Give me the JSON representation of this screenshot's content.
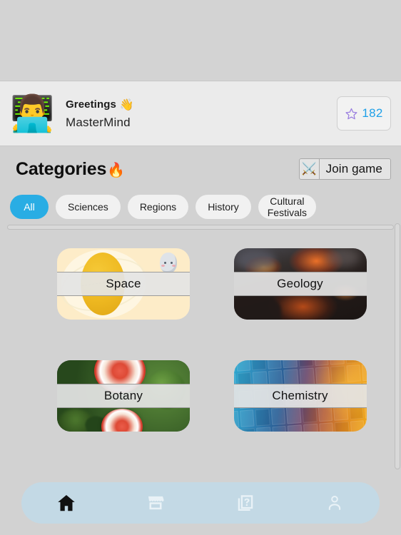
{
  "app": {
    "background_color": "#d2d2d2"
  },
  "header": {
    "avatar_icon": "man-technologist-emoji",
    "avatar_glyph": "👨‍💻",
    "greeting_text": "Greetings",
    "greeting_emoji": "👋",
    "user_name": "MasterMind",
    "score": {
      "icon": "star-icon",
      "value": "182",
      "value_color": "#1fa0e8",
      "star_color": "#9b7fe0"
    }
  },
  "title_row": {
    "title": "Categories",
    "title_emoji": "🔥",
    "join_button": {
      "label": "Join game",
      "icon": "crossed-swords-icon",
      "icon_glyph": "⚔️"
    }
  },
  "filters": {
    "active_index": 0,
    "active_color": "#29ade4",
    "chips": [
      {
        "label": "All"
      },
      {
        "label": "Sciences"
      },
      {
        "label": "Regions"
      },
      {
        "label": "History"
      },
      {
        "label": "Cultural\nFestivals"
      }
    ]
  },
  "categories": [
    {
      "label": "Space",
      "art": "art-space"
    },
    {
      "label": "Geology",
      "art": "art-geology"
    },
    {
      "label": "Botany",
      "art": "art-botany"
    },
    {
      "label": "Chemistry",
      "art": "art-chemistry"
    }
  ],
  "bottom_nav": {
    "background_color": "#c3d9e5",
    "active_index": 0,
    "items": [
      {
        "icon": "home-icon",
        "label": "Home"
      },
      {
        "icon": "store-icon",
        "label": "Store"
      },
      {
        "icon": "quiz-icon",
        "label": "Quiz"
      },
      {
        "icon": "profile-icon",
        "label": "Profile"
      }
    ]
  }
}
